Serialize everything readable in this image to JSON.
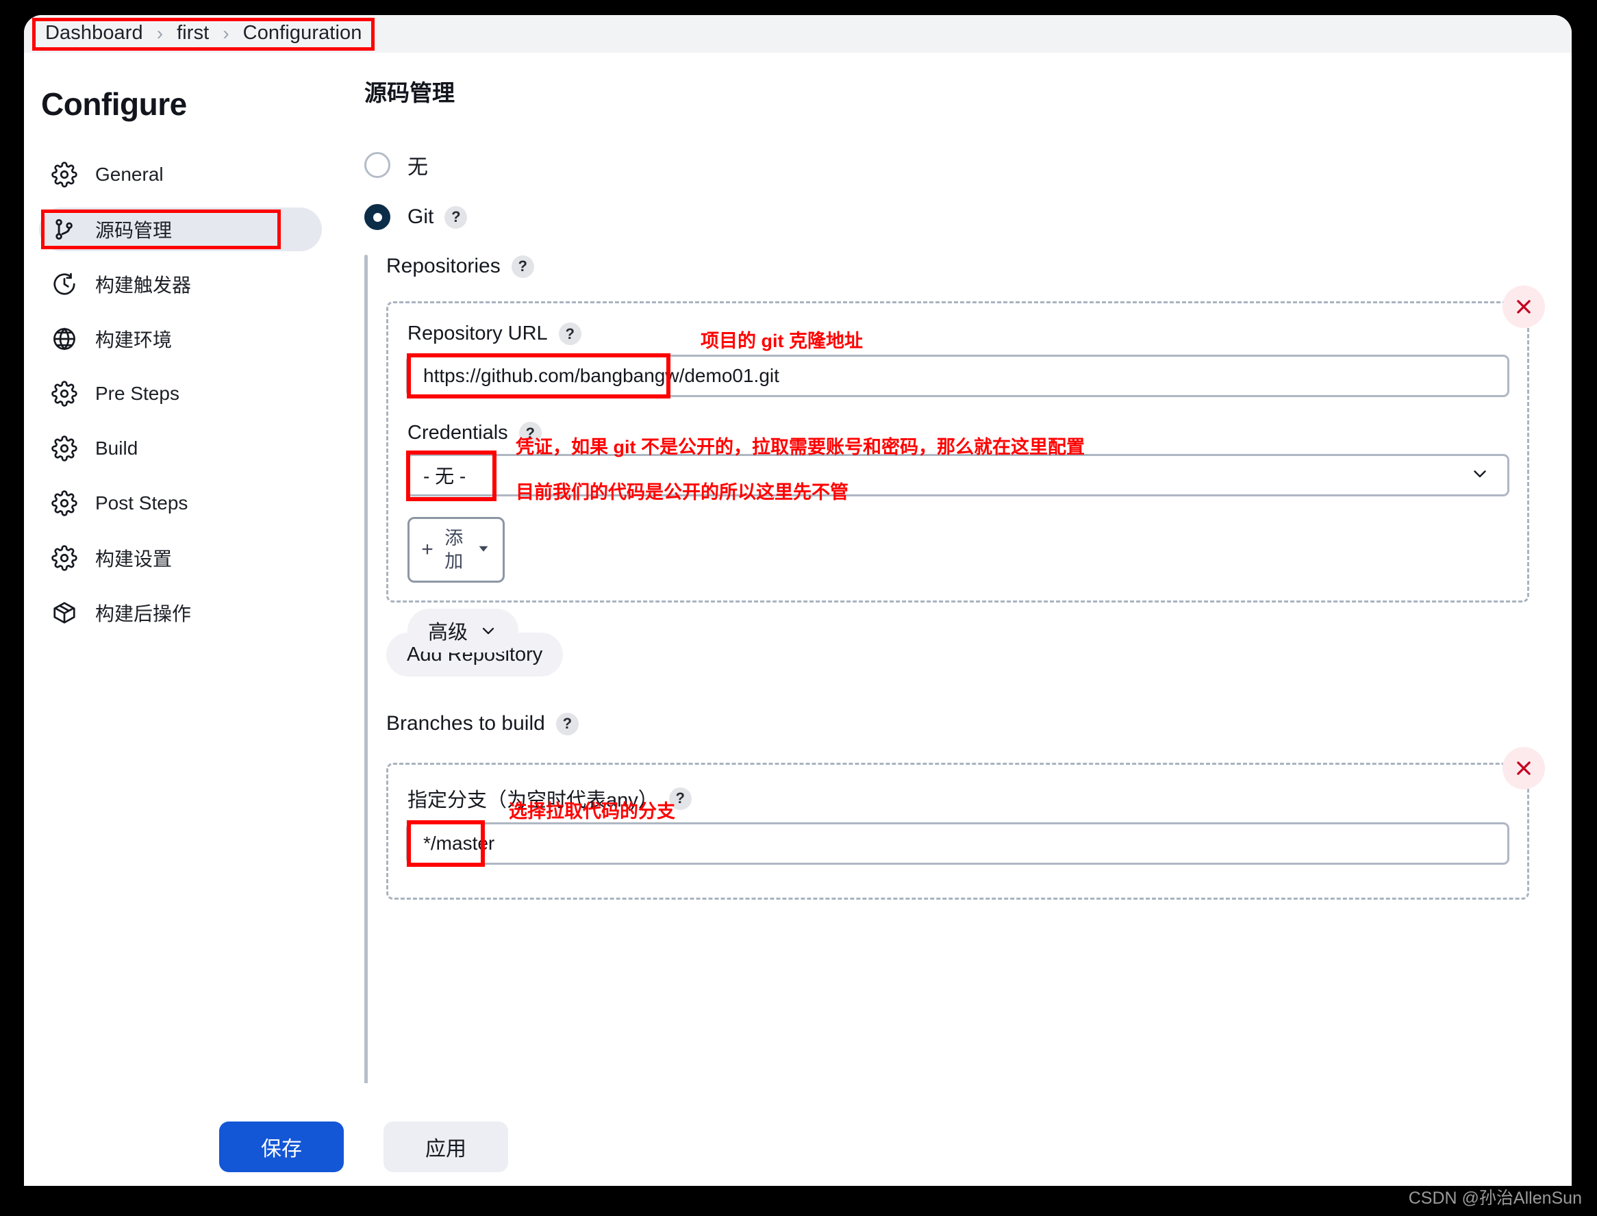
{
  "breadcrumb": {
    "items": [
      "Dashboard",
      "first",
      "Configuration"
    ],
    "separator": "›"
  },
  "sidebar": {
    "title": "Configure",
    "items": [
      {
        "label": "General",
        "icon": "gear-icon",
        "active": false
      },
      {
        "label": "源码管理",
        "icon": "branch-icon",
        "active": true
      },
      {
        "label": "构建触发器",
        "icon": "clock-icon",
        "active": false
      },
      {
        "label": "构建环境",
        "icon": "globe-icon",
        "active": false
      },
      {
        "label": "Pre Steps",
        "icon": "gear-icon",
        "active": false
      },
      {
        "label": "Build",
        "icon": "gear-icon",
        "active": false
      },
      {
        "label": "Post Steps",
        "icon": "gear-icon",
        "active": false
      },
      {
        "label": "构建设置",
        "icon": "gear-icon",
        "active": false
      },
      {
        "label": "构建后操作",
        "icon": "package-icon",
        "active": false
      }
    ]
  },
  "main": {
    "section_title": "源码管理",
    "scm_options": [
      {
        "label": "无",
        "selected": false,
        "has_help": false
      },
      {
        "label": "Git",
        "selected": true,
        "has_help": true
      }
    ],
    "repositories_label": "Repositories",
    "repository": {
      "url_label": "Repository URL",
      "url_value": "https://github.com/bangbangw/demo01.git",
      "credentials_label": "Credentials",
      "credentials_value": "- 无 -",
      "add_button_label": "添加",
      "add_button_plus": "+",
      "advanced_label": "高级"
    },
    "add_repository_label": "Add Repository",
    "branches": {
      "section_label": "Branches to build",
      "specifier_label": "指定分支（为空时代表any）",
      "specifier_value": "*/master"
    },
    "help_badge": "?"
  },
  "annotations": {
    "url_note": "项目的 git 克隆地址",
    "credentials_note_line1": "凭证，如果 git 不是公开的，拉取需要账号和密码，那么就在这里配置",
    "credentials_note_line2": "目前我们的代码是公开的所以这里先不管",
    "branch_note": "选择拉取代码的分支"
  },
  "actions": {
    "save_label": "保存",
    "apply_label": "应用"
  },
  "watermark": "CSDN @孙治AllenSun",
  "colors": {
    "annotation_red": "#ff0000",
    "primary_blue": "#1356d6",
    "radio_selected": "#0c2d48",
    "sidebar_active": "#e6e8ef"
  }
}
